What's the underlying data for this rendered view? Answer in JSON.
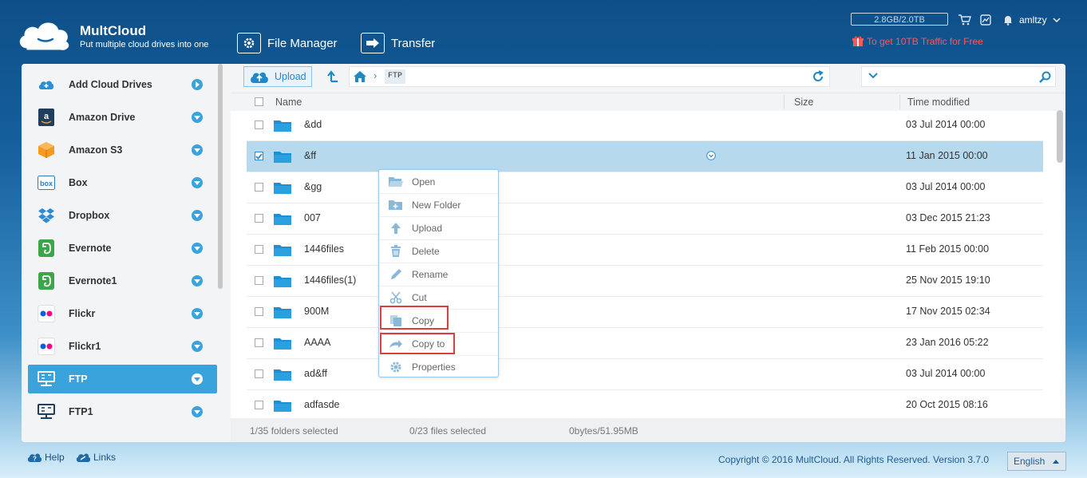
{
  "app": {
    "brand": "MultCloud",
    "tagline": "Put multiple cloud drives into one"
  },
  "topnav": [
    {
      "label": "File Manager",
      "icon": "gear-icon"
    },
    {
      "label": "Transfer",
      "icon": "arrow-right-icon"
    }
  ],
  "header": {
    "quota": "2.8GB/2.0TB",
    "promo": "To get 10TB Traffic for Free",
    "user": "amltzy"
  },
  "sidebar": {
    "items": [
      {
        "label": "Add Cloud Drives",
        "icon": "add-cloud-icon",
        "active": false
      },
      {
        "label": "Amazon Drive",
        "icon": "amazon-drive-icon",
        "active": false
      },
      {
        "label": "Amazon S3",
        "icon": "amazon-s3-icon",
        "active": false
      },
      {
        "label": "Box",
        "icon": "box-icon",
        "active": false
      },
      {
        "label": "Dropbox",
        "icon": "dropbox-icon",
        "active": false
      },
      {
        "label": "Evernote",
        "icon": "evernote-icon",
        "active": false
      },
      {
        "label": "Evernote1",
        "icon": "evernote-icon",
        "active": false
      },
      {
        "label": "Flickr",
        "icon": "flickr-icon",
        "active": false
      },
      {
        "label": "Flickr1",
        "icon": "flickr-icon",
        "active": false
      },
      {
        "label": "FTP",
        "icon": "ftp-icon",
        "active": true
      },
      {
        "label": "FTP1",
        "icon": "ftp-icon",
        "active": false
      }
    ]
  },
  "toolbar": {
    "upload_label": "Upload",
    "breadcrumb": [
      "FTP"
    ],
    "search_value": ""
  },
  "table": {
    "columns": {
      "name": "Name",
      "size": "Size",
      "time": "Time modified"
    },
    "rows": [
      {
        "name": "&dd",
        "size": "",
        "time": "03 Jul 2014 00:00",
        "selected": false
      },
      {
        "name": "&ff",
        "size": "",
        "time": "11 Jan 2015 00:00",
        "selected": true
      },
      {
        "name": "&gg",
        "size": "",
        "time": "03 Jul 2014 00:00",
        "selected": false
      },
      {
        "name": "007",
        "size": "",
        "time": "03 Dec 2015 21:23",
        "selected": false
      },
      {
        "name": "1446files",
        "size": "",
        "time": "11 Feb 2015 00:00",
        "selected": false
      },
      {
        "name": "1446files(1)",
        "size": "",
        "time": "25 Nov 2015 19:10",
        "selected": false
      },
      {
        "name": "900M",
        "size": "",
        "time": "17 Nov 2015 02:34",
        "selected": false
      },
      {
        "name": "AAAA",
        "size": "",
        "time": "23 Jan 2016 05:22",
        "selected": false
      },
      {
        "name": "ad&ff",
        "size": "",
        "time": "03 Jul 2014 00:00",
        "selected": false
      },
      {
        "name": "adfasde",
        "size": "",
        "time": "20 Oct 2015 08:16",
        "selected": false
      }
    ]
  },
  "status": {
    "folders": "1/35 folders selected",
    "files": "0/23 files selected",
    "bytes": "0bytes/51.95MB"
  },
  "context_menu": [
    {
      "label": "Open",
      "icon": "folder-open-icon",
      "highlighted": false
    },
    {
      "label": "New Folder",
      "icon": "new-folder-icon",
      "highlighted": false
    },
    {
      "label": "Upload",
      "icon": "upload-arrow-icon",
      "highlighted": false
    },
    {
      "label": "Delete",
      "icon": "trash-icon",
      "highlighted": false
    },
    {
      "label": "Rename",
      "icon": "pencil-icon",
      "highlighted": false
    },
    {
      "label": "Cut",
      "icon": "scissors-icon",
      "highlighted": false
    },
    {
      "label": "Copy",
      "icon": "copy-icon",
      "highlighted": true
    },
    {
      "label": "Copy to",
      "icon": "copy-to-icon",
      "highlighted": true
    },
    {
      "label": "Properties",
      "icon": "gear-icon",
      "highlighted": false
    }
  ],
  "footer": {
    "help": "Help",
    "links": "Links",
    "copyright": "Copyright © 2016 MultCloud. All Rights Reserved. Version 3.7.0",
    "language": "English"
  },
  "colors": {
    "accent": "#3aa3db",
    "selected_row": "#b7d9ee",
    "highlight_box": "#e03c3c",
    "promo": "#ff5757"
  }
}
